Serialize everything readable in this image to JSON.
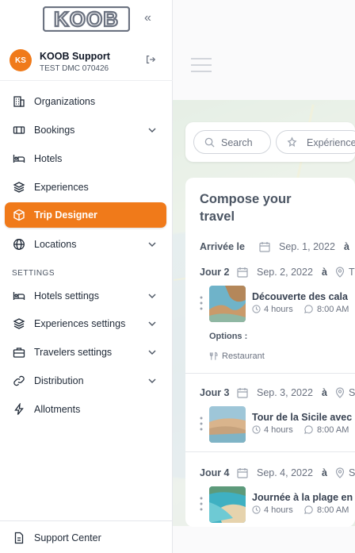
{
  "brand": {
    "logo_text": "KOOB",
    "accent": "#f07a1a"
  },
  "user": {
    "initials": "KS",
    "name": "KOOB Support",
    "org": "TEST DMC 070426"
  },
  "nav": [
    {
      "label": "Organizations",
      "icon": "building-icon",
      "expandable": false
    },
    {
      "label": "Bookings",
      "icon": "ticket-icon",
      "expandable": true
    },
    {
      "label": "Hotels",
      "icon": "bed-icon",
      "expandable": false
    },
    {
      "label": "Experiences",
      "icon": "layers-icon",
      "expandable": false
    },
    {
      "label": "Trip Designer",
      "icon": "cube-icon",
      "expandable": false,
      "active": true
    },
    {
      "label": "Locations",
      "icon": "globe-icon",
      "expandable": true
    }
  ],
  "settings_title": "SETTINGS",
  "settings_nav": [
    {
      "label": "Hotels settings",
      "icon": "bed-icon"
    },
    {
      "label": "Experiences settings",
      "icon": "layers-icon"
    },
    {
      "label": "Travelers settings",
      "icon": "briefcase-icon"
    },
    {
      "label": "Distribution",
      "icon": "link-icon"
    },
    {
      "label": "Allotments",
      "icon": "bolt-icon"
    }
  ],
  "support_label": "Support Center",
  "search": {
    "placeholder": "Search",
    "experience_filter": "Expérience"
  },
  "compose": {
    "title_line1": "Compose your",
    "title_line2": "travel",
    "arrival_label": "Arrivée le",
    "arrival_date": "Sep. 1, 2022",
    "a": "à",
    "days": [
      {
        "label": "Jour 2",
        "date": "Sep. 2, 2022",
        "place": "T",
        "activity": "Découverte des cala",
        "duration": "4 hours",
        "time": "8:00 AM",
        "options_label": "Options :",
        "option": "Restaurant"
      },
      {
        "label": "Jour 3",
        "date": "Sep. 3, 2022",
        "place": "S",
        "activity": "Tour de la Sicile avec",
        "duration": "4 hours",
        "time": "8:00 AM"
      },
      {
        "label": "Jour 4",
        "date": "Sep. 4, 2022",
        "place": "S",
        "activity": "Journée à la plage en",
        "duration": "4 hours",
        "time": "8:00 AM"
      }
    ]
  }
}
